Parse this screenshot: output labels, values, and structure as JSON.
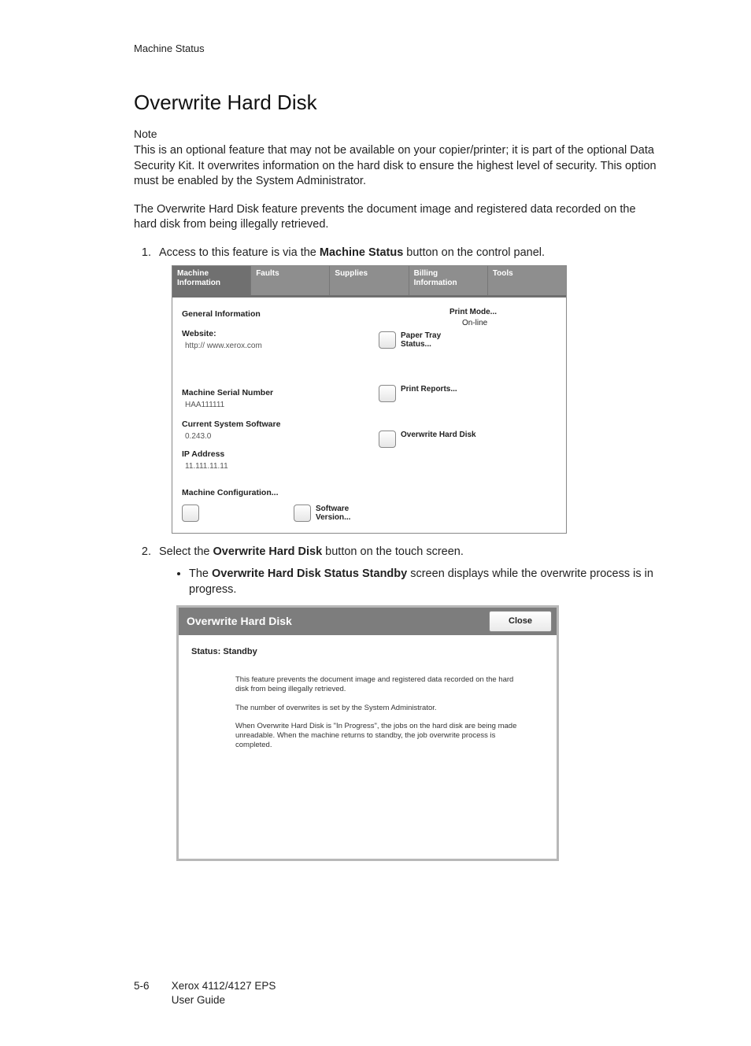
{
  "header": "Machine Status",
  "title": "Overwrite Hard Disk",
  "note_label": "Note",
  "note_body": "This is an optional feature that may not be available on your copier/printer; it is part of the optional Data Security Kit. It overwrites information on the hard disk to ensure the highest level of security. This option must be enabled by the System Administrator.",
  "intro": "The Overwrite Hard Disk feature prevents the document image and registered data recorded on the hard disk from being illegally retrieved.",
  "step1_a": "Access to this feature is via the ",
  "step1_bold": "Machine Status",
  "step1_b": " button on the control panel.",
  "step2_a": "Select the ",
  "step2_bold": "Overwrite Hard Disk",
  "step2_b": " button on the touch screen.",
  "bullet_a": "The ",
  "bullet_bold": "Overwrite Hard Disk Status Standby",
  "bullet_b": " screen displays while the overwrite process is in progress.",
  "panel1": {
    "tabs": {
      "machine_info": "Machine\nInformation",
      "faults": "Faults",
      "supplies": "Supplies",
      "billing": "Billing\nInformation",
      "tools": "Tools"
    },
    "general_info": "General Information",
    "website_label": "Website:",
    "website_val": "http:// www.xerox.com",
    "serial_label": "Machine Serial Number",
    "serial_val": "HAA111111",
    "software_label": "Current System Software",
    "software_val": "0.243.0",
    "ip_label": "IP Address",
    "ip_val": "11.111.11.11",
    "machine_config": "Machine Configuration...",
    "software_version": "Software\nVersion...",
    "print_mode_label": "Print Mode...",
    "print_mode_val": "On-line",
    "paper_tray": "Paper Tray\nStatus...",
    "print_reports": "Print Reports...",
    "overwrite_hd": "Overwrite Hard Disk"
  },
  "panel2": {
    "title": "Overwrite Hard Disk",
    "close": "Close",
    "status": "Status: Standby",
    "p1": "This feature prevents the document image and registered data recorded on the hard disk from being illegally retrieved.",
    "p2": "The number of overwrites is set by the System Administrator.",
    "p3": "When Overwrite Hard Disk is \"In Progress\", the jobs on the hard disk are being made unreadable. When the machine returns to standby, the job overwrite process is completed."
  },
  "footer": {
    "page_num": "5-6",
    "product": "Xerox 4112/4127 EPS",
    "guide": "User Guide"
  }
}
